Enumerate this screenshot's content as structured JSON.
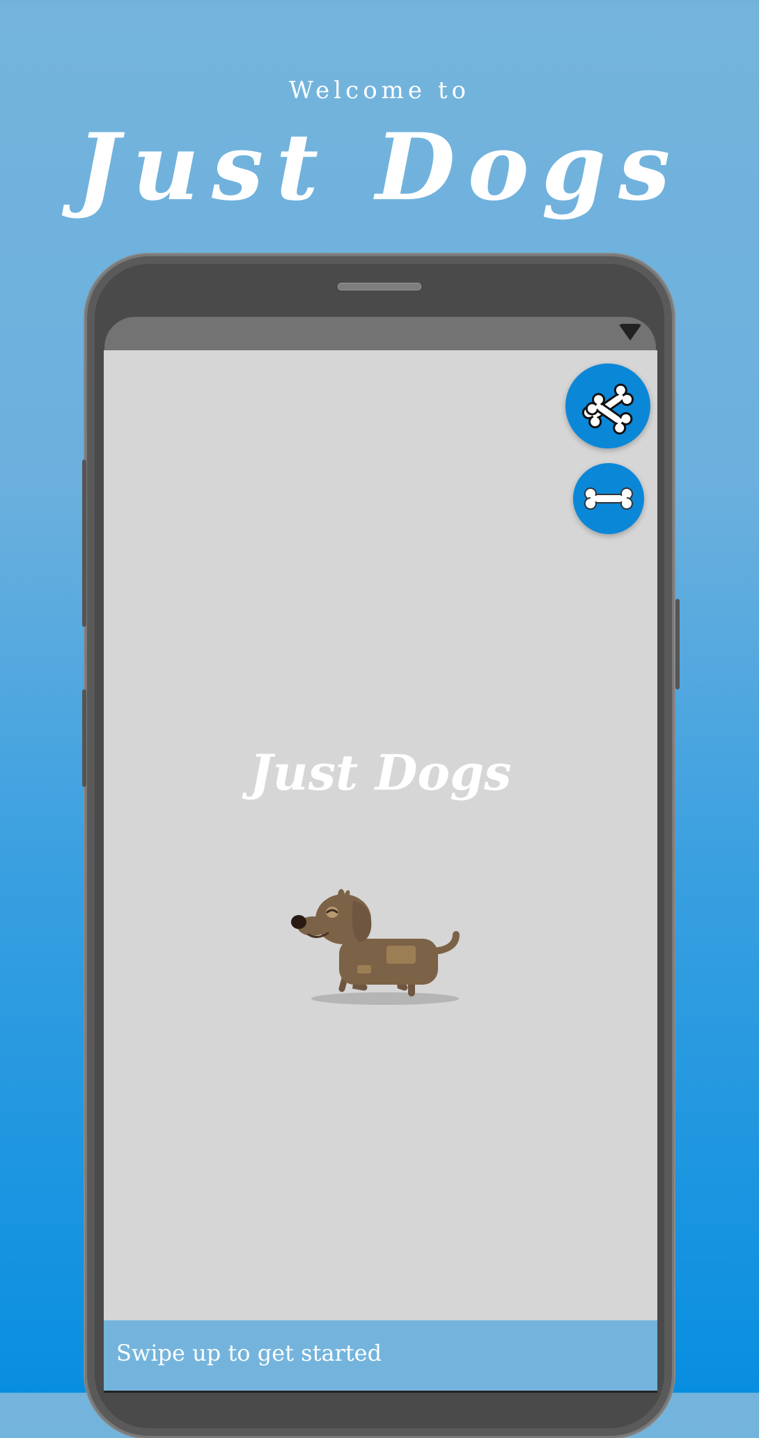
{
  "header": {
    "welcome": "Welcome to",
    "title": "Just Dogs"
  },
  "screen": {
    "title": "Just Dogs",
    "illustration": "dachshund-dog"
  },
  "fabs": {
    "primary_icon": "crossed-bones-icon",
    "secondary_icon": "bone-icon"
  },
  "bottom_bar": {
    "label": "Swipe up to get started"
  },
  "colors": {
    "accent": "#0b87d8",
    "screen_bg": "#d6d6d6",
    "bottom_bar": "#74b4dc"
  }
}
